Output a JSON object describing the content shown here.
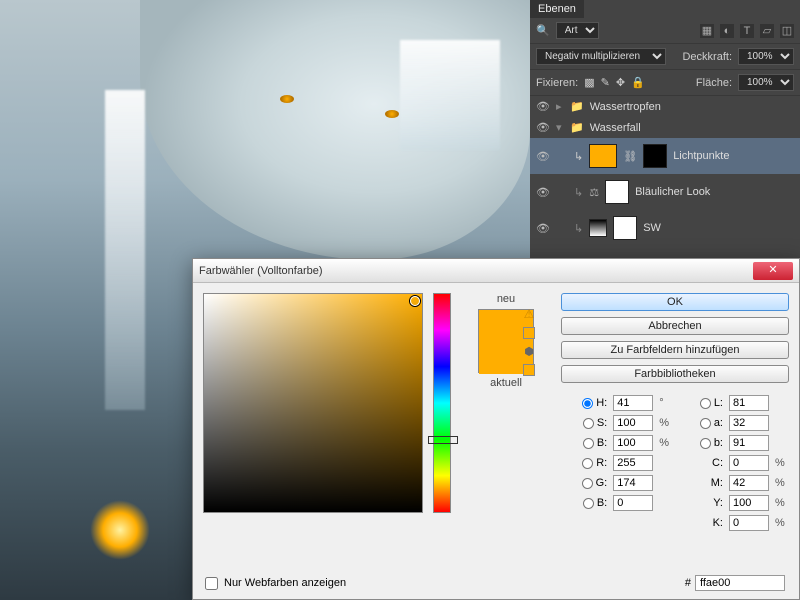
{
  "panel": {
    "tab": "Ebenen",
    "filter": "Art",
    "blend": "Negativ multiplizieren",
    "opacity_label": "Deckkraft:",
    "opacity": "100%",
    "fill_label": "Fläche:",
    "fill": "100%",
    "lock_label": "Fixieren:",
    "layers": [
      {
        "name": "Wassertropfen",
        "type": "folder"
      },
      {
        "name": "Wasserfall",
        "type": "folder"
      },
      {
        "name": "Lichtpunkte",
        "type": "adj",
        "selected": true,
        "thumb": "orange"
      },
      {
        "name": "Bläulicher Look",
        "type": "adj",
        "thumb": "white"
      },
      {
        "name": "SW",
        "type": "adj",
        "thumb": "white"
      }
    ]
  },
  "dialog": {
    "title": "Farbwähler (Volltonfarbe)",
    "ok": "OK",
    "cancel": "Abbrechen",
    "addSwatch": "Zu Farbfeldern hinzufügen",
    "libraries": "Farbbibliotheken",
    "neu": "neu",
    "aktuell": "aktuell",
    "webonly": "Nur Webfarben anzeigen",
    "hex_prefix": "#",
    "hex": "ffae00",
    "hsv": {
      "H": "41",
      "S": "100",
      "B": "100"
    },
    "rgb": {
      "R": "255",
      "G": "174",
      "B": "0"
    },
    "lab": {
      "L": "81",
      "a": "32",
      "b": "91"
    },
    "cmyk": {
      "C": "0",
      "M": "42",
      "Y": "100",
      "K": "0"
    },
    "deg": "°",
    "pct": "%"
  }
}
